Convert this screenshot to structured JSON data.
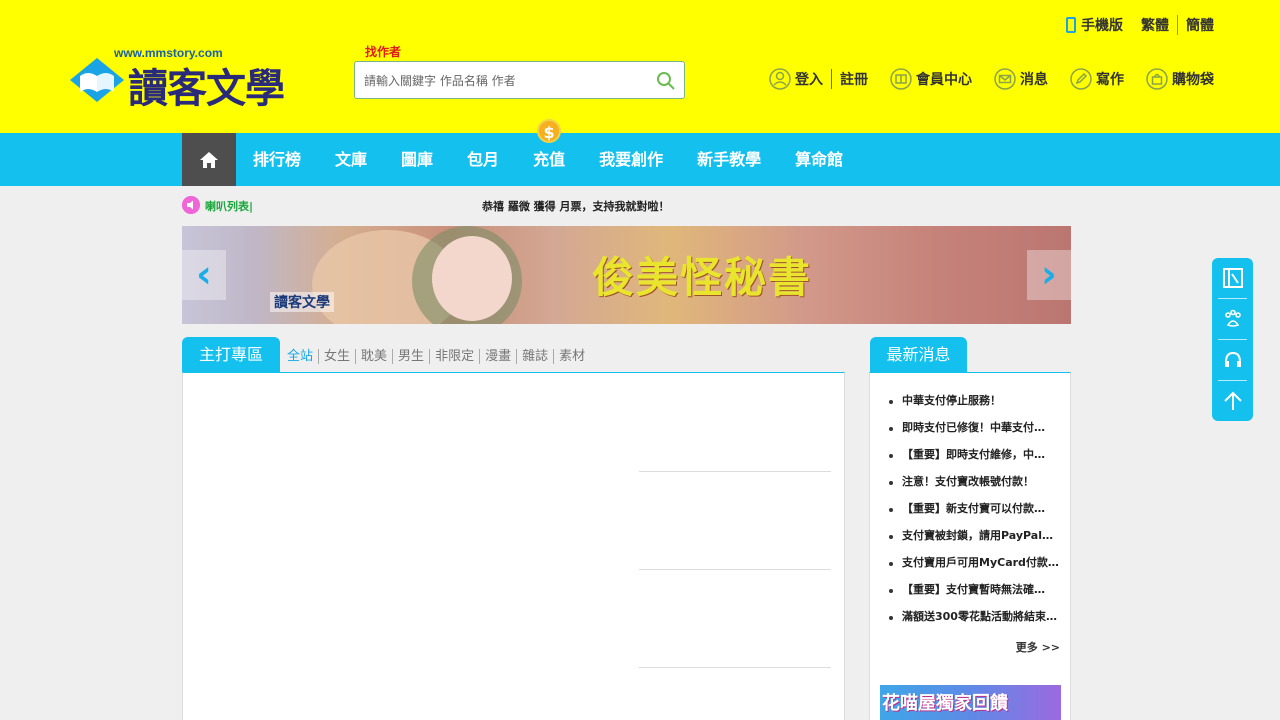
{
  "header": {
    "logo_url": "www.mmstory.com",
    "logo_text": "讀客文學",
    "search_label": "找作者",
    "search_placeholder": "請輸入關鍵字 作品名稱 作者",
    "top_links": {
      "mobile": "手機版",
      "traditional": "繁體",
      "simplified": "簡體"
    },
    "user_links": {
      "login": "登入",
      "register": "註冊",
      "member": "會員中心",
      "messages": "消息",
      "write": "寫作",
      "cart": "購物袋"
    }
  },
  "nav": {
    "items": [
      "排行榜",
      "文庫",
      "圖庫",
      "包月",
      "充值",
      "我要創作",
      "新手教學",
      "算命館"
    ],
    "coin_symbol": "$"
  },
  "ticker": {
    "label": "喇叭列表|",
    "message": "恭禧 羅微 獲得 月票，支持我就對啦！"
  },
  "banner": {
    "title": "俊美怪秘書",
    "logo_text": "讀客文學",
    "prev": "‹",
    "next": "›"
  },
  "featured": {
    "tab": "主打專區",
    "categories": [
      "全站",
      "女生",
      "耽美",
      "男生",
      "非限定",
      "漫畫",
      "雜誌",
      "素材"
    ]
  },
  "news": {
    "tab": "最新消息",
    "items": [
      "中華支付停止服務！",
      "即時支付已修復！中華支付…",
      "【重要】即時支付維修，中…",
      "注意！支付寶改帳號付款！",
      "【重要】新支付寶可以付款…",
      "支付寶被封鎖，請用PayPal…",
      "支付寶用戶可用MyCard付款…",
      "【重要】支付寶暫時無法確…",
      "滿額送300零花點活動將結束…"
    ],
    "more": "更多 >>",
    "ad_text": "花喵屋獨家回饋"
  },
  "colors": {
    "header_bg": "#ffff00",
    "accent": "#13c0ee",
    "home_bg": "#4e4e4e"
  }
}
